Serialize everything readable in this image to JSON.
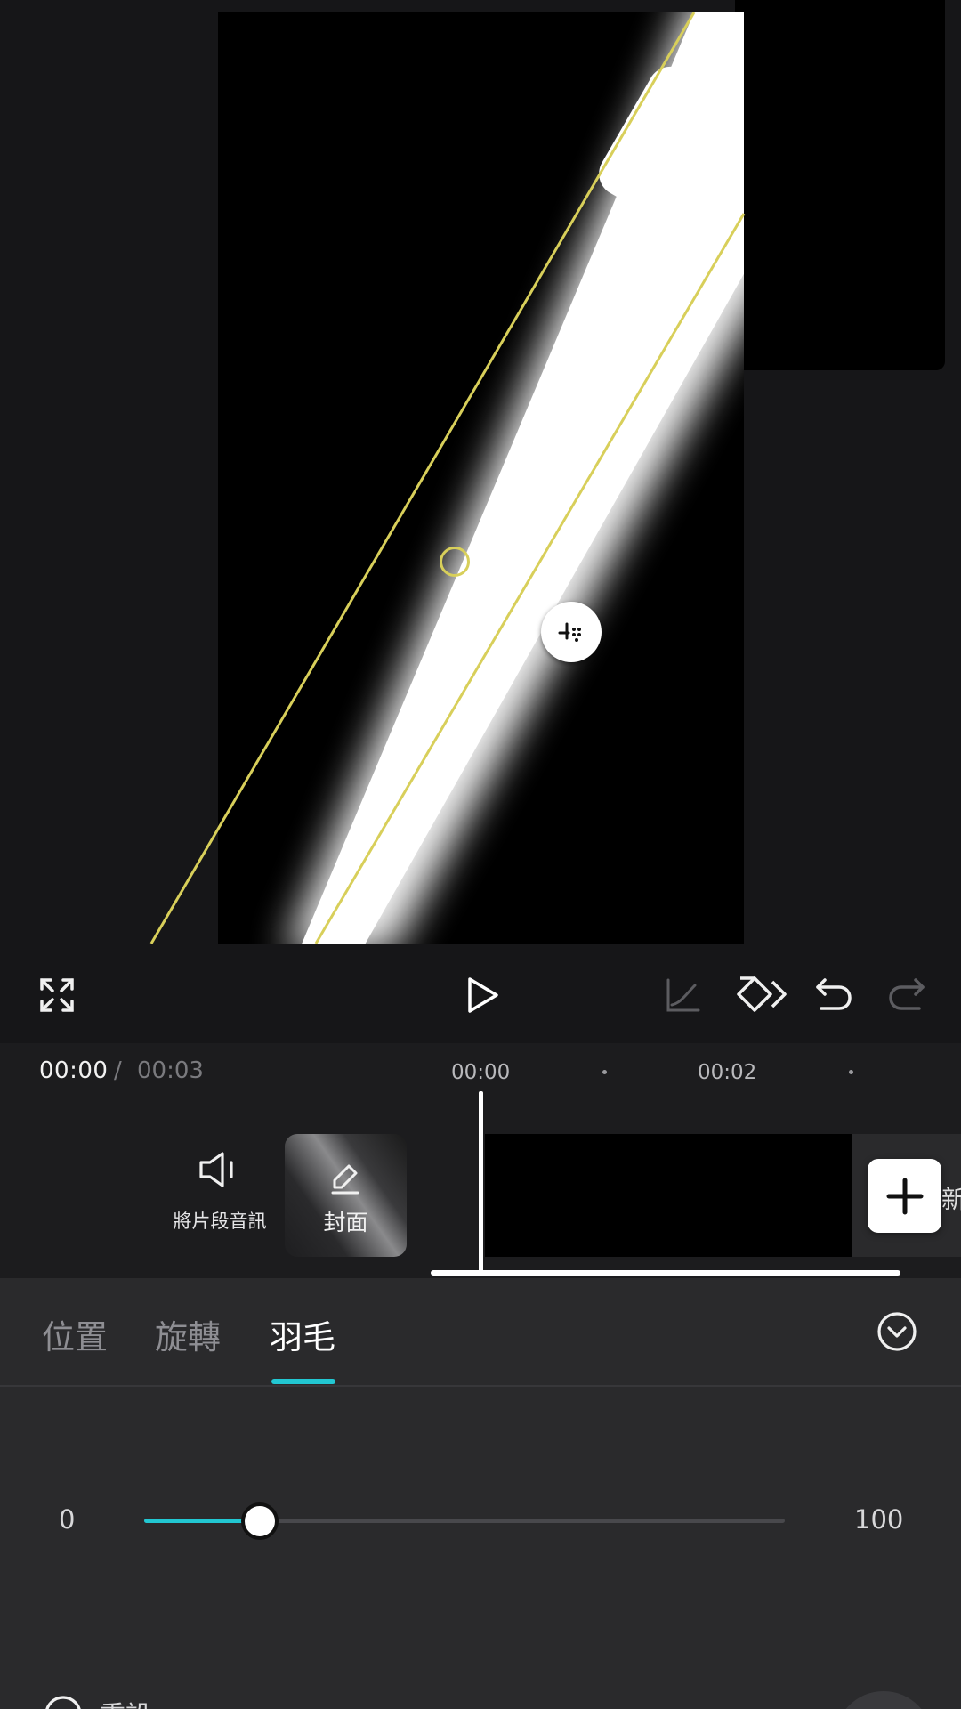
{
  "timeline": {
    "current_time": "00:00",
    "separator": "/",
    "total_time": "00:03",
    "ruler_marks": [
      "00:00",
      "00:02"
    ],
    "audio_label": "將片段音訊",
    "cover_label": "封面",
    "add_clip_partial_text": "新"
  },
  "tabs": [
    {
      "label": "位置",
      "active": false
    },
    {
      "label": "旋轉",
      "active": false
    },
    {
      "label": "羽毛",
      "active": true
    }
  ],
  "slider": {
    "min_label": "0",
    "max_label": "100",
    "value": 18,
    "min": 0,
    "max": 100
  },
  "reset": {
    "label": "重設"
  },
  "colors": {
    "accent": "#22c7d2",
    "mask_outline": "#d8cf5a",
    "background": "#161618",
    "panel": "#2a2a2c"
  },
  "icons": {
    "fullscreen": "fullscreen-icon",
    "play": "play-icon",
    "curve": "curve-icon",
    "keyframe": "keyframe-icon",
    "undo": "undo-icon",
    "redo": "redo-icon",
    "audio": "speaker-icon",
    "cover_edit": "pencil-icon",
    "add": "plus-icon",
    "collapse": "chevron-down-icon",
    "feather_handle": "feather-icon",
    "reset": "reset-icon"
  }
}
